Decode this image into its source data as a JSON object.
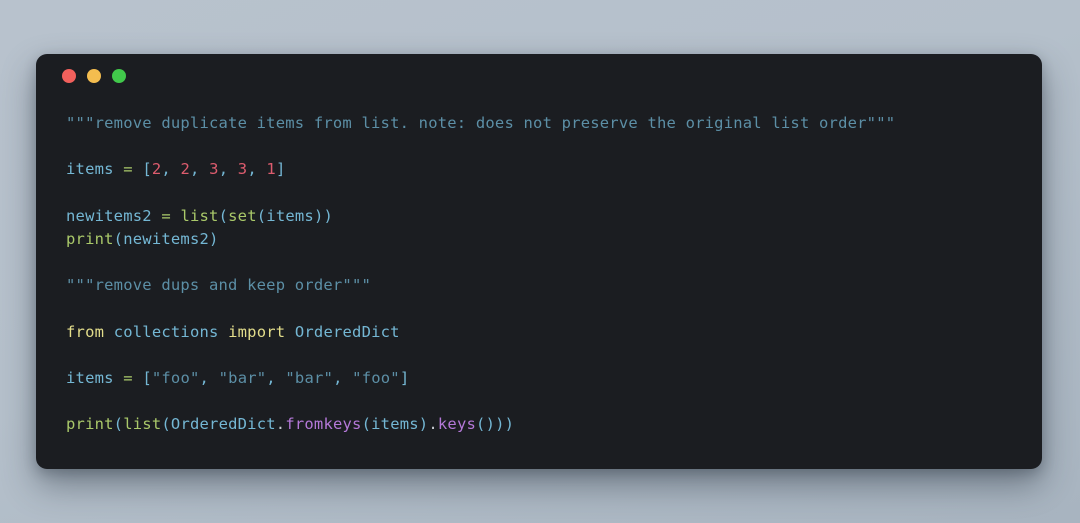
{
  "window": {
    "title_bar": {
      "buttons": [
        {
          "name": "close",
          "icon": "traffic-light-close",
          "color": "#f2605c"
        },
        {
          "name": "minimize",
          "icon": "traffic-light-minimize",
          "color": "#f4bd4f"
        },
        {
          "name": "maximize",
          "icon": "traffic-light-maximize",
          "color": "#41c84b"
        }
      ]
    },
    "background_color": "#1b1d21",
    "page_background_color": "#b8c2cd"
  },
  "code": {
    "language": "python",
    "lines": [
      {
        "id": "l1",
        "text": "\"\"\"remove duplicate items from list. note: does not preserve the original list order\"\"\""
      },
      {
        "id": "l2",
        "text": ""
      },
      {
        "id": "l3",
        "text": "items = [2, 2, 3, 3, 1]"
      },
      {
        "id": "l4",
        "text": ""
      },
      {
        "id": "l5",
        "text": "newitems2 = list(set(items))"
      },
      {
        "id": "l6",
        "text": "print(newitems2)"
      },
      {
        "id": "l7",
        "text": ""
      },
      {
        "id": "l8",
        "text": "\"\"\"remove dups and keep order\"\"\""
      },
      {
        "id": "l9",
        "text": ""
      },
      {
        "id": "l10",
        "text": "from collections import OrderedDict"
      },
      {
        "id": "l11",
        "text": ""
      },
      {
        "id": "l12",
        "text": "items = [\"foo\", \"bar\", \"bar\", \"foo\"]"
      },
      {
        "id": "l13",
        "text": ""
      },
      {
        "id": "l14",
        "text": "print(list(OrderedDict.fromkeys(items).keys()))"
      }
    ],
    "tokens": {
      "l1": [
        {
          "c": "t-string",
          "t": "\"\"\"remove duplicate items from list. note: does not preserve the original list order\"\"\""
        }
      ],
      "l3": [
        {
          "c": "t-ident",
          "t": "items"
        },
        {
          "c": "t-plain",
          "t": " "
        },
        {
          "c": "t-op",
          "t": "="
        },
        {
          "c": "t-plain",
          "t": " "
        },
        {
          "c": "t-punct",
          "t": "["
        },
        {
          "c": "t-number",
          "t": "2"
        },
        {
          "c": "t-punct",
          "t": ","
        },
        {
          "c": "t-plain",
          "t": " "
        },
        {
          "c": "t-number",
          "t": "2"
        },
        {
          "c": "t-punct",
          "t": ","
        },
        {
          "c": "t-plain",
          "t": " "
        },
        {
          "c": "t-number",
          "t": "3"
        },
        {
          "c": "t-punct",
          "t": ","
        },
        {
          "c": "t-plain",
          "t": " "
        },
        {
          "c": "t-number",
          "t": "3"
        },
        {
          "c": "t-punct",
          "t": ","
        },
        {
          "c": "t-plain",
          "t": " "
        },
        {
          "c": "t-number",
          "t": "1"
        },
        {
          "c": "t-punct",
          "t": "]"
        }
      ],
      "l5": [
        {
          "c": "t-ident",
          "t": "newitems2"
        },
        {
          "c": "t-plain",
          "t": " "
        },
        {
          "c": "t-op",
          "t": "="
        },
        {
          "c": "t-plain",
          "t": " "
        },
        {
          "c": "t-func",
          "t": "list"
        },
        {
          "c": "t-punct",
          "t": "("
        },
        {
          "c": "t-func",
          "t": "set"
        },
        {
          "c": "t-punct",
          "t": "("
        },
        {
          "c": "t-ident",
          "t": "items"
        },
        {
          "c": "t-punct",
          "t": "))"
        }
      ],
      "l6": [
        {
          "c": "t-func",
          "t": "print"
        },
        {
          "c": "t-punct",
          "t": "("
        },
        {
          "c": "t-ident",
          "t": "newitems2"
        },
        {
          "c": "t-punct",
          "t": ")"
        }
      ],
      "l8": [
        {
          "c": "t-string",
          "t": "\"\"\"remove dups and keep order\"\"\""
        }
      ],
      "l10": [
        {
          "c": "t-keyword",
          "t": "from"
        },
        {
          "c": "t-plain",
          "t": " "
        },
        {
          "c": "t-ident",
          "t": "collections"
        },
        {
          "c": "t-plain",
          "t": " "
        },
        {
          "c": "t-keyword",
          "t": "import"
        },
        {
          "c": "t-plain",
          "t": " "
        },
        {
          "c": "t-ident",
          "t": "OrderedDict"
        }
      ],
      "l12": [
        {
          "c": "t-ident",
          "t": "items"
        },
        {
          "c": "t-plain",
          "t": " "
        },
        {
          "c": "t-op",
          "t": "="
        },
        {
          "c": "t-plain",
          "t": " "
        },
        {
          "c": "t-punct",
          "t": "["
        },
        {
          "c": "t-string",
          "t": "\"foo\""
        },
        {
          "c": "t-punct",
          "t": ","
        },
        {
          "c": "t-plain",
          "t": " "
        },
        {
          "c": "t-string",
          "t": "\"bar\""
        },
        {
          "c": "t-punct",
          "t": ","
        },
        {
          "c": "t-plain",
          "t": " "
        },
        {
          "c": "t-string",
          "t": "\"bar\""
        },
        {
          "c": "t-punct",
          "t": ","
        },
        {
          "c": "t-plain",
          "t": " "
        },
        {
          "c": "t-string",
          "t": "\"foo\""
        },
        {
          "c": "t-punct",
          "t": "]"
        }
      ],
      "l14": [
        {
          "c": "t-func",
          "t": "print"
        },
        {
          "c": "t-punct",
          "t": "("
        },
        {
          "c": "t-func",
          "t": "list"
        },
        {
          "c": "t-punct",
          "t": "("
        },
        {
          "c": "t-ident",
          "t": "OrderedDict"
        },
        {
          "c": "t-dot",
          "t": "."
        },
        {
          "c": "t-method",
          "t": "fromkeys"
        },
        {
          "c": "t-punct",
          "t": "("
        },
        {
          "c": "t-ident",
          "t": "items"
        },
        {
          "c": "t-punct",
          "t": ")"
        },
        {
          "c": "t-dot",
          "t": "."
        },
        {
          "c": "t-method",
          "t": "keys"
        },
        {
          "c": "t-punct",
          "t": "()))"
        }
      ]
    }
  }
}
